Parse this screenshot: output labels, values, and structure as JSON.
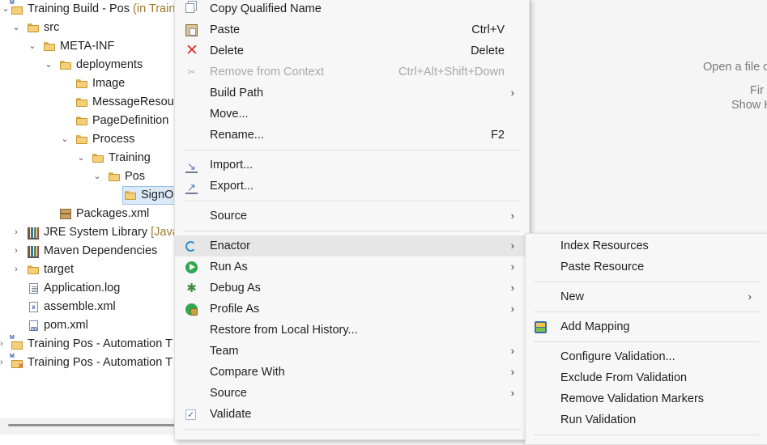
{
  "tree": {
    "items": [
      {
        "label": "Training Build - Pos",
        "decoration": "(in Train",
        "twisty": "⌄",
        "icon": "project-icon"
      },
      {
        "label": "src",
        "twisty": "⌄",
        "icon": "folder-icon"
      },
      {
        "label": "META-INF",
        "twisty": "⌄",
        "icon": "folder-icon"
      },
      {
        "label": "deployments",
        "twisty": "⌄",
        "icon": "folder-icon"
      },
      {
        "label": "Image",
        "twisty": "",
        "icon": "folder-icon"
      },
      {
        "label": "MessageResour",
        "twisty": "",
        "icon": "folder-icon"
      },
      {
        "label": "PageDefinition",
        "twisty": "",
        "icon": "folder-icon"
      },
      {
        "label": "Process",
        "twisty": "⌄",
        "icon": "folder-icon"
      },
      {
        "label": "Training",
        "twisty": "⌄",
        "icon": "folder-icon"
      },
      {
        "label": "Pos",
        "twisty": "⌄",
        "icon": "folder-icon"
      },
      {
        "label": "SignO",
        "twisty": "",
        "icon": "folder-icon"
      },
      {
        "label": "Packages.xml",
        "twisty": "",
        "icon": "package-icon"
      },
      {
        "label": "JRE System Library",
        "decoration": "[Java",
        "twisty": "›",
        "icon": "library-icon"
      },
      {
        "label": "Maven Dependencies",
        "twisty": "›",
        "icon": "library-icon"
      },
      {
        "label": "target",
        "twisty": "›",
        "icon": "folder-icon"
      },
      {
        "label": "Application.log",
        "twisty": "",
        "icon": "log-file-icon"
      },
      {
        "label": "assemble.xml",
        "twisty": "",
        "icon": "xml-file-icon"
      },
      {
        "label": "pom.xml",
        "twisty": "",
        "icon": "pom-file-icon"
      },
      {
        "label": "Training Pos - Automation T",
        "twisty": "›",
        "icon": "project-icon"
      },
      {
        "label": "Training Pos - Automation T",
        "twisty": "›",
        "icon": "project-error-icon"
      }
    ]
  },
  "editor": {
    "hint_open": "Open a file o",
    "hint_find": "Fir",
    "hint_show": "Show K"
  },
  "context_menu": {
    "items": [
      {
        "label": "Copy Qualified Name",
        "shortcut": "",
        "icon": "copy-icon"
      },
      {
        "label": "Paste",
        "shortcut": "Ctrl+V",
        "icon": "paste-icon"
      },
      {
        "label": "Delete",
        "shortcut": "Delete",
        "icon": "delete-icon"
      },
      {
        "label": "Remove from Context",
        "shortcut": "Ctrl+Alt+Shift+Down",
        "icon": "remove-context-icon",
        "disabled": true
      },
      {
        "label": "Build Path",
        "shortcut": "",
        "submenu": true
      },
      {
        "label": "Move...",
        "shortcut": ""
      },
      {
        "label": "Rename...",
        "shortcut": "F2"
      },
      {
        "label": "Import...",
        "shortcut": "",
        "icon": "import-icon"
      },
      {
        "label": "Export...",
        "shortcut": "",
        "icon": "export-icon"
      },
      {
        "label": "Source",
        "shortcut": "",
        "submenu": true
      },
      {
        "label": "Enactor",
        "shortcut": "",
        "submenu": true,
        "icon": "enactor-icon",
        "highlighted": true
      },
      {
        "label": "Run As",
        "shortcut": "",
        "submenu": true,
        "icon": "run-icon"
      },
      {
        "label": "Debug As",
        "shortcut": "",
        "submenu": true,
        "icon": "debug-icon"
      },
      {
        "label": "Profile As",
        "shortcut": "",
        "submenu": true,
        "icon": "profile-icon"
      },
      {
        "label": "Restore from Local History...",
        "shortcut": ""
      },
      {
        "label": "Team",
        "shortcut": "",
        "submenu": true
      },
      {
        "label": "Compare With",
        "shortcut": "",
        "submenu": true
      },
      {
        "label": "Source",
        "shortcut": "",
        "submenu": true
      },
      {
        "label": "Validate",
        "shortcut": "",
        "icon": "validate-check-icon"
      }
    ],
    "arrow": "›"
  },
  "enactor_submenu": {
    "items": [
      {
        "label": "Index Resources"
      },
      {
        "label": "Paste Resource"
      },
      {
        "label": "New",
        "submenu": true
      },
      {
        "label": "Add Mapping",
        "icon": "add-mapping-icon"
      },
      {
        "label": "Configure Validation..."
      },
      {
        "label": "Exclude From Validation"
      },
      {
        "label": "Remove Validation Markers"
      },
      {
        "label": "Run Validation"
      }
    ],
    "arrow": "›"
  }
}
